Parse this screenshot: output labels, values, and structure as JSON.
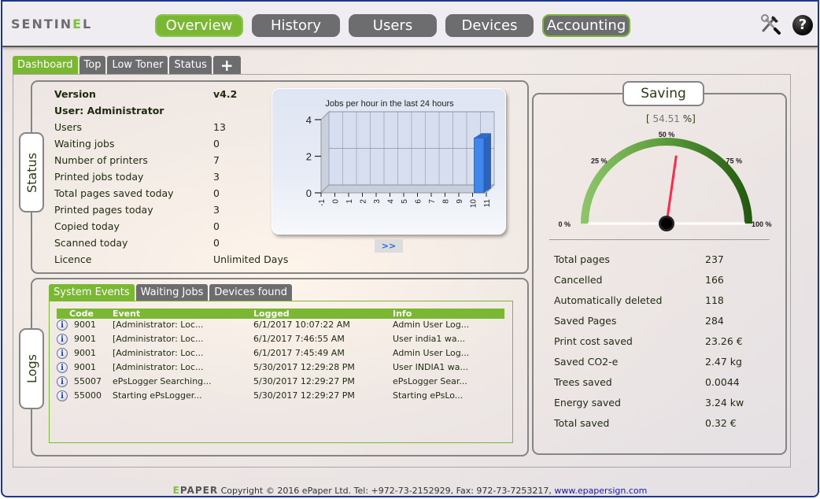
{
  "app": {
    "logo_prefix": "SENTIN",
    "logo_accent": "E",
    "logo_suffix": "L"
  },
  "nav": [
    {
      "label": "Overview",
      "active": true
    },
    {
      "label": "History",
      "active": false
    },
    {
      "label": "Users",
      "active": false
    },
    {
      "label": "Devices",
      "active": false
    },
    {
      "label": "Accounting",
      "active": false
    }
  ],
  "header_icons": [
    "tools-icon",
    "help-icon"
  ],
  "tabs": [
    {
      "label": "Dashboard",
      "active": true
    },
    {
      "label": "Top",
      "active": false
    },
    {
      "label": "Low Toner",
      "active": false
    },
    {
      "label": "Status",
      "active": false
    },
    {
      "label": "+",
      "active": false
    }
  ],
  "status": {
    "label": "Status",
    "rows": [
      {
        "key": "Version",
        "value": "v4.2",
        "bold": true
      },
      {
        "key": "User: Administrator",
        "value": "",
        "bold": true
      },
      {
        "key": "Users",
        "value": "13"
      },
      {
        "key": "Waiting jobs",
        "value": "0"
      },
      {
        "key": "Number of printers",
        "value": "7"
      },
      {
        "key": "Printed jobs today",
        "value": "3"
      },
      {
        "key": "Total pages saved today",
        "value": "0"
      },
      {
        "key": "Printed pages today",
        "value": "3"
      },
      {
        "key": "Copied today",
        "value": "0"
      },
      {
        "key": "Scanned today",
        "value": "0"
      },
      {
        "key": "Licence",
        "value": "Unlimited Days"
      }
    ],
    "more_label": ">>"
  },
  "chart_data": {
    "type": "bar",
    "title": "Jobs per hour in the last 24 hours",
    "categories": [
      "-1",
      "0",
      "1",
      "2",
      "3",
      "4",
      "5",
      "6",
      "7",
      "8",
      "9",
      "10",
      "11"
    ],
    "values": [
      0,
      0,
      0,
      0,
      0,
      0,
      0,
      0,
      0,
      0,
      0,
      3,
      0
    ],
    "xlabel": "",
    "ylabel": "",
    "ylim": [
      0,
      4
    ],
    "yticks": [
      "0",
      "2",
      "4"
    ],
    "grid": true,
    "bar_color": "#3f86ee"
  },
  "saving": {
    "title": "Saving",
    "percent_open": "[",
    "percent_value": "54.51",
    "percent_close": "%]",
    "gauge": {
      "value": 54.51,
      "min": 0,
      "max": 100,
      "tick_labels": [
        "0 %",
        "25 %",
        "50 %",
        "75 %",
        "100 %"
      ]
    },
    "rows": [
      {
        "key": "Total pages",
        "value": "237"
      },
      {
        "key": "Cancelled",
        "value": "166"
      },
      {
        "key": "Automatically deleted",
        "value": "118"
      },
      {
        "key": "Saved Pages",
        "value": "284"
      },
      {
        "key": "Print cost saved",
        "value": "23.26 €"
      },
      {
        "key": "Saved CO2-e",
        "value": "2.47 kg"
      },
      {
        "key": "Trees saved",
        "value": "0.0044"
      },
      {
        "key": "Energy saved",
        "value": "3.24 kw"
      },
      {
        "key": "Total saved",
        "value": "0.32 €"
      }
    ]
  },
  "logs": {
    "label": "Logs",
    "tabs": [
      {
        "label": "System Events",
        "active": true
      },
      {
        "label": "Waiting Jobs",
        "active": false
      },
      {
        "label": "Devices found",
        "active": false
      }
    ],
    "columns": [
      "Code",
      "Event",
      "Logged",
      "Info"
    ],
    "rows": [
      {
        "code": "9001",
        "event": "[Administrator: Loc...",
        "logged": "6/1/2017 10:07:22 AM",
        "info": "Admin User Log..."
      },
      {
        "code": "9001",
        "event": "[Administrator: Loc...",
        "logged": "6/1/2017 7:46:55 AM",
        "info": "User india1 wa..."
      },
      {
        "code": "9001",
        "event": "[Administrator: Loc...",
        "logged": "6/1/2017 7:45:49 AM",
        "info": "Admin User Log..."
      },
      {
        "code": "9001",
        "event": "[Administrator: Loc...",
        "logged": "5/30/2017 12:29:28 PM",
        "info": "User INDIA1 wa..."
      },
      {
        "code": "55007",
        "event": "ePsLogger Searching...",
        "logged": "5/30/2017 12:29:27 PM",
        "info": "ePsLogger Sear..."
      },
      {
        "code": "55000",
        "event": "Starting ePsLogger...",
        "logged": "5/30/2017 12:29:27 PM",
        "info": "Starting ePsLo..."
      }
    ]
  },
  "footer": {
    "brand_accent": "E",
    "brand_rest": "PAPER",
    "text": " Copyright © 2016 ePaper Ltd. Tel: +972-73-2152929, Fax: 972-73-7253217, ",
    "link": "www.epapersign.com"
  },
  "colors": {
    "accent_green": "#7ab733",
    "nav_gray": "#6d6d70",
    "frame_blue": "#1a3790",
    "needle_red": "#ff2a4a"
  }
}
